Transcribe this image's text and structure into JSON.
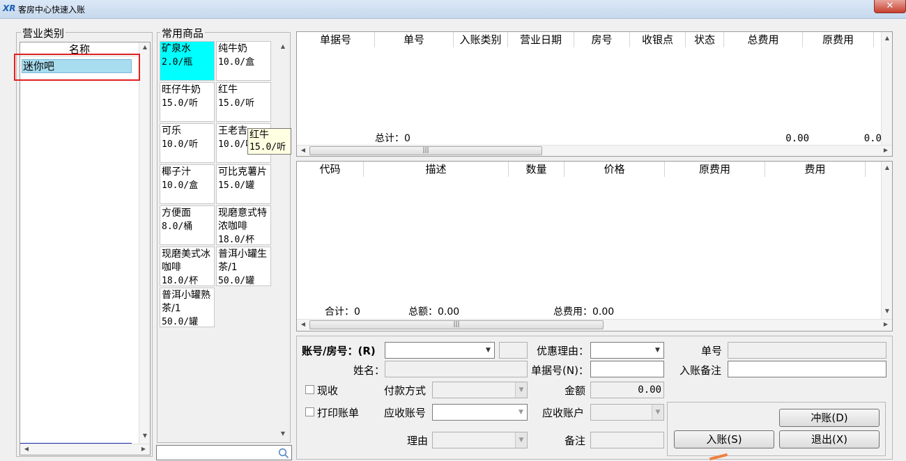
{
  "window": {
    "title": "客房中心快速入账",
    "logo": "XR",
    "close_glyph": "✕"
  },
  "category_panel": {
    "title": "营业类别",
    "column_header": "名称",
    "items": [
      "迷你吧"
    ]
  },
  "products_panel": {
    "title": "常用商品",
    "items": [
      {
        "name": "矿泉水",
        "price": "2.0/瓶",
        "selected": true
      },
      {
        "name": "纯牛奶",
        "price": "10.0/盒"
      },
      {
        "name": "旺仔牛奶",
        "price": "15.0/听"
      },
      {
        "name": "红牛",
        "price": "15.0/听"
      },
      {
        "name": "可乐",
        "price": "10.0/听"
      },
      {
        "name": "王老吉",
        "price": "10.0/听"
      },
      {
        "name": "椰子汁",
        "price": "10.0/盒"
      },
      {
        "name": "可比克薯片",
        "price": "15.0/罐"
      },
      {
        "name": "方便面",
        "price": "8.0/桶"
      },
      {
        "name": "现磨意式特浓咖啡",
        "price": "18.0/杯"
      },
      {
        "name": "现磨美式冰咖啡",
        "price": "18.0/杯"
      },
      {
        "name": "普洱小罐生茶/1",
        "price": "50.0/罐"
      },
      {
        "name": "普洱小罐熟茶/1",
        "price": "50.0/罐"
      }
    ],
    "tooltip": {
      "name": "红牛",
      "price": "15.0/听"
    }
  },
  "bills_grid": {
    "headers": [
      "单据号",
      "单号",
      "入账类别",
      "营业日期",
      "房号",
      "收银点",
      "状态",
      "总费用",
      "原费用"
    ],
    "footer_count": "总计：0",
    "footer_total": "0.00",
    "footer_total2": "0.0"
  },
  "items_grid": {
    "headers": [
      "代码",
      "描述",
      "数量",
      "价格",
      "原费用",
      "费用"
    ],
    "footer_count": "合计：0",
    "footer_amount": "总额：0.00",
    "footer_fee": "总费用：0.00"
  },
  "form": {
    "account_label": "账号/房号：(R)",
    "discount_label": "优惠理由：",
    "bill_no_label": "单号",
    "name_label": "姓名：",
    "doc_no_label": "单据号(N)：",
    "remark_label": "入账备注",
    "cash_label": "现收",
    "pay_method_label": "付款方式",
    "amount_label": "金额",
    "amount_value": "0.00",
    "print_label": "打印账单",
    "recv_account_label": "应收账号",
    "recv_user_label": "应收账户",
    "reason_label": "理由",
    "note_label": "备注"
  },
  "buttons": {
    "reverse": "冲账(D)",
    "post": "入账(S)",
    "exit": "退出(X)"
  },
  "icons": {
    "search": "search-icon"
  }
}
